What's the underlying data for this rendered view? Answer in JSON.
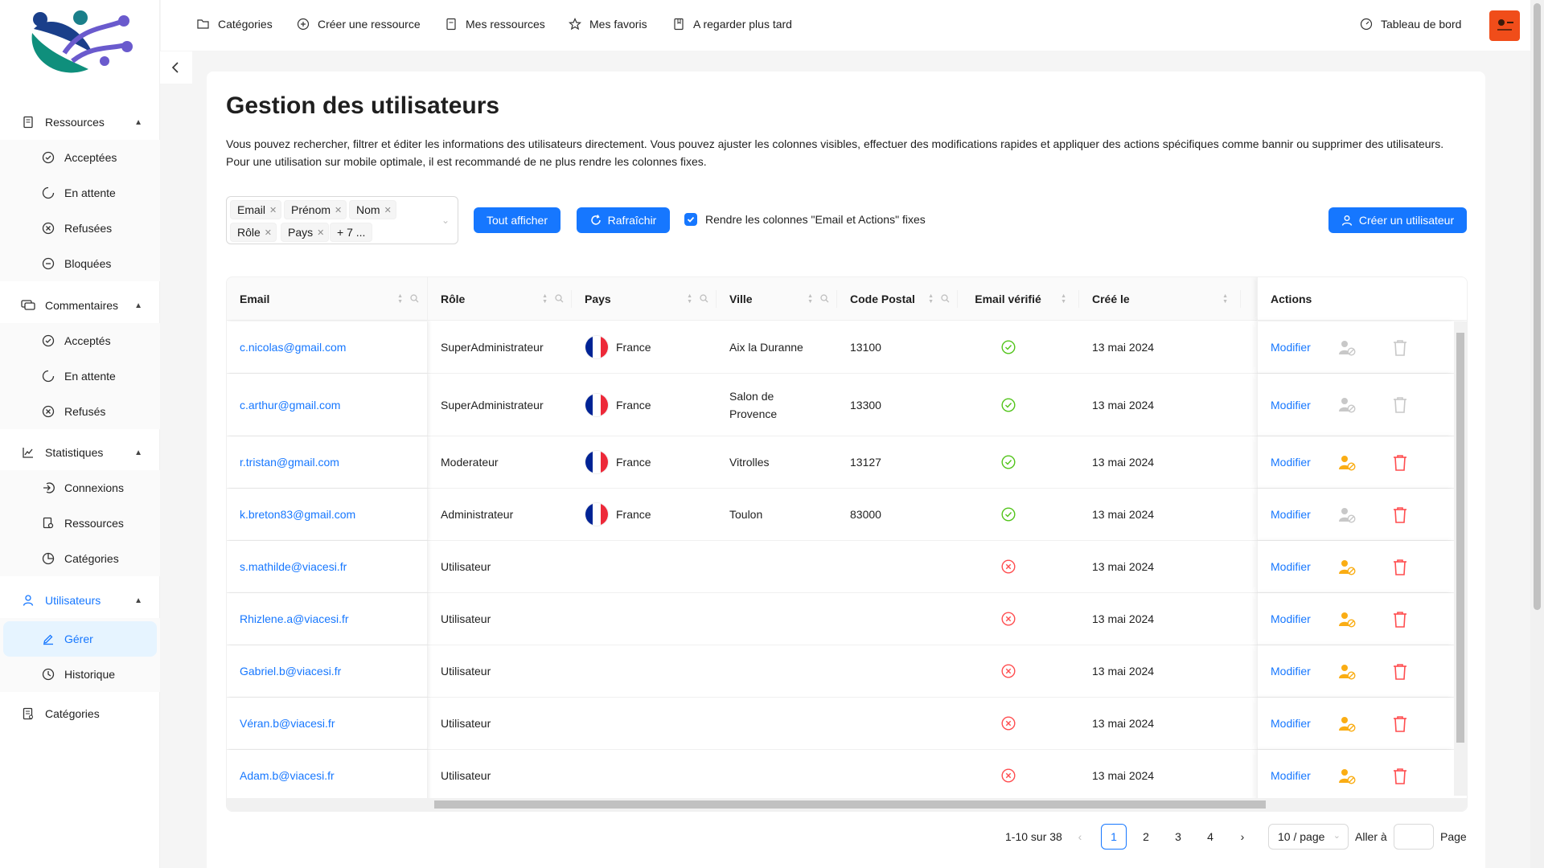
{
  "topbar": {
    "links": [
      "Catégories",
      "Créer une ressource",
      "Mes ressources",
      "Mes favoris",
      "A regarder plus tard"
    ],
    "dashboard": "Tableau de bord"
  },
  "sidebar": {
    "ressources": {
      "label": "Ressources",
      "items": [
        "Acceptées",
        "En attente",
        "Refusées",
        "Bloquées"
      ]
    },
    "commentaires": {
      "label": "Commentaires",
      "items": [
        "Acceptés",
        "En attente",
        "Refusés"
      ]
    },
    "statistiques": {
      "label": "Statistiques",
      "items": [
        "Connexions",
        "Ressources",
        "Catégories"
      ]
    },
    "utilisateurs": {
      "label": "Utilisateurs",
      "items": [
        "Gérer",
        "Historique"
      ]
    },
    "categories": "Catégories"
  },
  "colors": {
    "accent": "#1677ff",
    "success": "#52c41a",
    "error": "#ff4d4f",
    "warning": "#faad14",
    "avatar": "#f04d1a"
  },
  "main": {
    "title": "Gestion des utilisateurs",
    "description": "Vous pouvez rechercher, filtrer et éditer les informations des utilisateurs directement. Vous pouvez ajuster les colonnes visibles, effectuer des modifications rapides et appliquer des actions spécifiques comme bannir ou supprimer des utilisateurs. Pour une utilisation sur mobile optimale, il est recommandé de ne plus rendre les colonnes fixes.",
    "column_tags": [
      "Email",
      "Prénom",
      "Nom",
      "Rôle",
      "Pays"
    ],
    "more_tags": "+ 7 ...",
    "show_all": "Tout afficher",
    "refresh": "Rafraîchir",
    "fixed_label": "Rendre les colonnes \"Email et Actions\" fixes",
    "create_user": "Créer un utilisateur"
  },
  "table": {
    "headers": {
      "email": "Email",
      "role": "Rôle",
      "pays": "Pays",
      "ville": "Ville",
      "cp": "Code Postal",
      "verified": "Email vérifié",
      "created": "Créé le",
      "actions": "Actions"
    },
    "action_label": "Modifier",
    "rows": [
      {
        "email": "c.nicolas@gmail.com",
        "role": "SuperAdministrateur",
        "pays": "France",
        "ville": "Aix la Duranne",
        "cp": "13100",
        "verified": true,
        "created": "13 mai 2024",
        "can_ban": false,
        "can_delete": false
      },
      {
        "email": "c.arthur@gmail.com",
        "role": "SuperAdministrateur",
        "pays": "France",
        "ville": "Salon de Provence",
        "cp": "13300",
        "verified": true,
        "created": "13 mai 2024",
        "can_ban": false,
        "can_delete": false
      },
      {
        "email": "r.tristan@gmail.com",
        "role": "Moderateur",
        "pays": "France",
        "ville": "Vitrolles",
        "cp": "13127",
        "verified": true,
        "created": "13 mai 2024",
        "can_ban": true,
        "can_delete": true
      },
      {
        "email": "k.breton83@gmail.com",
        "role": "Administrateur",
        "pays": "France",
        "ville": "Toulon",
        "cp": "83000",
        "verified": true,
        "created": "13 mai 2024",
        "can_ban": false,
        "can_delete": true
      },
      {
        "email": "s.mathilde@viacesi.fr",
        "role": "Utilisateur",
        "pays": "",
        "ville": "",
        "cp": "",
        "verified": false,
        "created": "13 mai 2024",
        "can_ban": true,
        "can_delete": true
      },
      {
        "email": "Rhizlene.a@viacesi.fr",
        "role": "Utilisateur",
        "pays": "",
        "ville": "",
        "cp": "",
        "verified": false,
        "created": "13 mai 2024",
        "can_ban": true,
        "can_delete": true
      },
      {
        "email": "Gabriel.b@viacesi.fr",
        "role": "Utilisateur",
        "pays": "",
        "ville": "",
        "cp": "",
        "verified": false,
        "created": "13 mai 2024",
        "can_ban": true,
        "can_delete": true
      },
      {
        "email": "Véran.b@viacesi.fr",
        "role": "Utilisateur",
        "pays": "",
        "ville": "",
        "cp": "",
        "verified": false,
        "created": "13 mai 2024",
        "can_ban": true,
        "can_delete": true
      },
      {
        "email": "Adam.b@viacesi.fr",
        "role": "Utilisateur",
        "pays": "",
        "ville": "",
        "cp": "",
        "verified": false,
        "created": "13 mai 2024",
        "can_ban": true,
        "can_delete": true
      }
    ]
  },
  "pagination": {
    "total": "1-10 sur 38",
    "pages": [
      "1",
      "2",
      "3",
      "4"
    ],
    "current": "1",
    "page_size": "10 / page",
    "goto_label": "Aller à",
    "page_label": "Page"
  }
}
